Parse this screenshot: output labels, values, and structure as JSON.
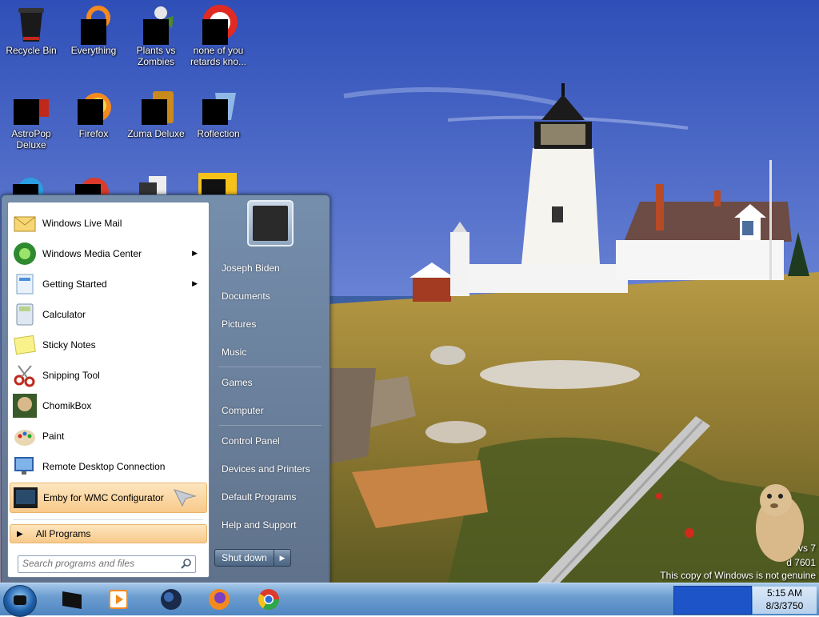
{
  "desktop": {
    "icons": [
      {
        "label": "Recycle Bin"
      },
      {
        "label": "Everything"
      },
      {
        "label": "Plants vs Zombies"
      },
      {
        "label": "none of you retards kno..."
      },
      {
        "label": "AstroPop Deluxe"
      },
      {
        "label": "Firefox"
      },
      {
        "label": "Zuma Deluxe"
      },
      {
        "label": "Roflection"
      }
    ]
  },
  "start_menu": {
    "programs": [
      {
        "label": "Windows Live Mail",
        "icon": "windows-live-mail-icon"
      },
      {
        "label": "Windows Media Center",
        "icon": "windows-media-center-icon",
        "has_submenu": true
      },
      {
        "label": "Getting Started",
        "icon": "getting-started-icon",
        "has_submenu": true
      },
      {
        "label": "Calculator",
        "icon": "calculator-icon"
      },
      {
        "label": "Sticky Notes",
        "icon": "sticky-notes-icon"
      },
      {
        "label": "Snipping Tool",
        "icon": "snipping-tool-icon"
      },
      {
        "label": "ChomikBox",
        "icon": "chomikbox-icon"
      },
      {
        "label": "Paint",
        "icon": "paint-icon"
      },
      {
        "label": "Remote Desktop Connection",
        "icon": "remote-desktop-icon"
      },
      {
        "label": "Emby for WMC Configurator",
        "icon": "emby-icon",
        "highlighted": true
      }
    ],
    "all_programs": "All Programs",
    "search_placeholder": "Search programs and files",
    "user_name": "Joseph Biden",
    "links": [
      {
        "label": "Documents"
      },
      {
        "label": "Pictures"
      },
      {
        "label": "Music"
      },
      {
        "label": "Games"
      },
      {
        "label": "Computer"
      },
      {
        "label": "Control Panel"
      },
      {
        "label": "Devices and Printers"
      },
      {
        "label": "Default Programs"
      },
      {
        "label": "Help and Support"
      }
    ],
    "shutdown_label": "Shut down"
  },
  "taskbar": {
    "pinned": [
      {
        "icon": "black-window-icon"
      },
      {
        "icon": "media-player-icon"
      },
      {
        "icon": "globe-icon"
      },
      {
        "icon": "firefox-icon"
      },
      {
        "icon": "chrome-icon"
      }
    ],
    "clock_time": "5:15 AM",
    "clock_date": "8/3/3750"
  },
  "watermark": {
    "line1": "vs 7",
    "line2": "d 7601",
    "line3": "This copy of Windows is not genuine"
  },
  "colors": {
    "menu_highlight": "#f8c98a",
    "taskbar": "#6d9ed0",
    "sky": "#3f5fc7",
    "tray": "#1d54c7"
  }
}
